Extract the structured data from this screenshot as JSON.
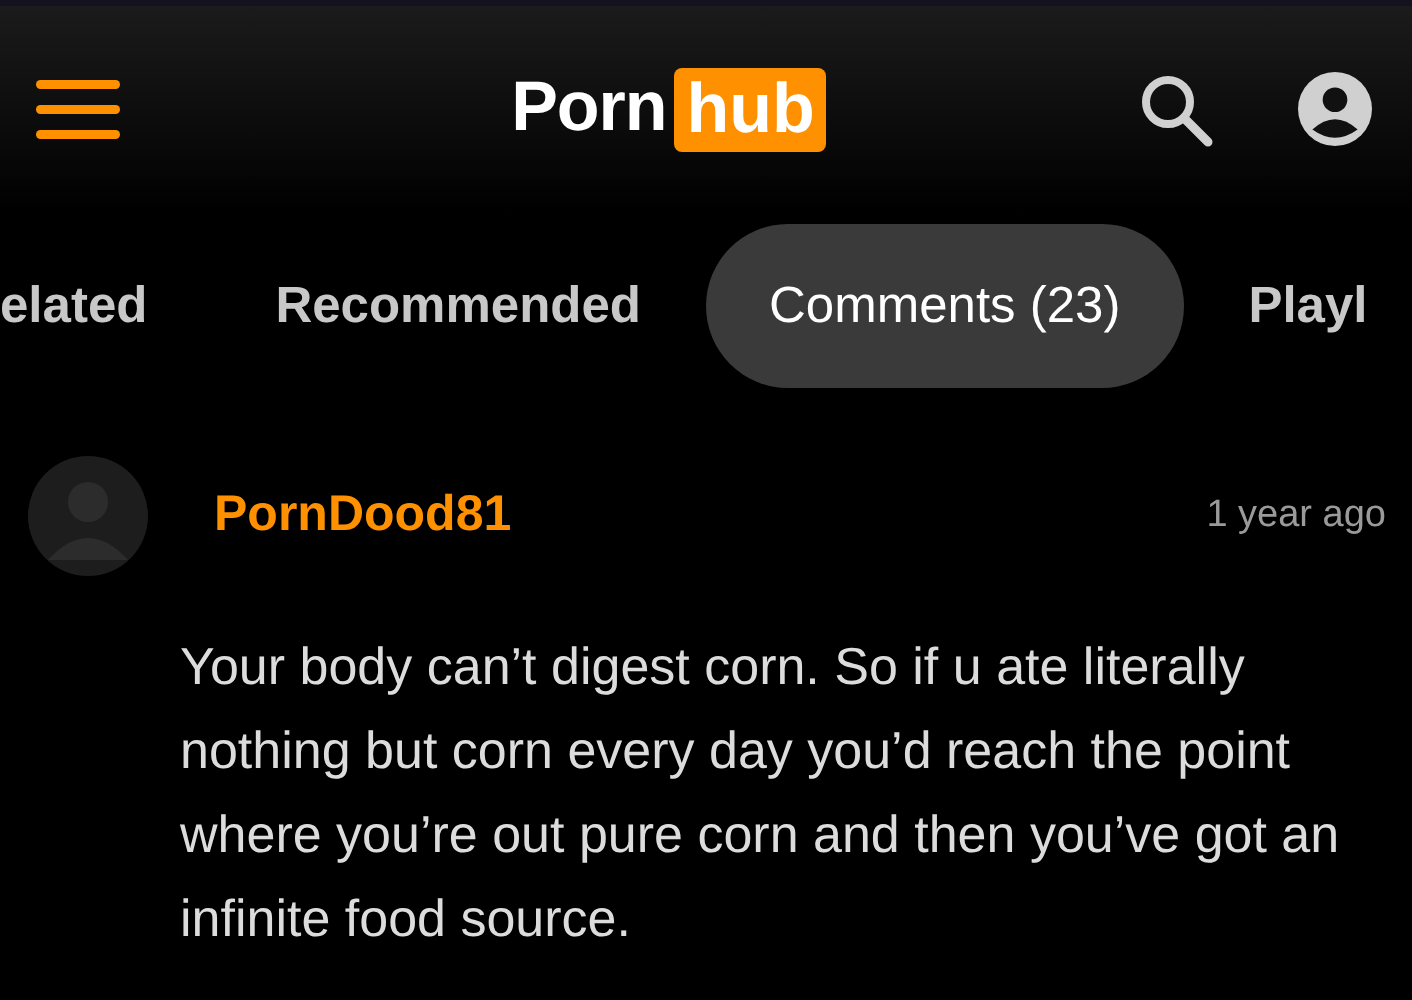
{
  "header": {
    "logo": {
      "text_1": "Porn",
      "text_2": "hub"
    }
  },
  "tabs": [
    {
      "label": "elated",
      "selected": false
    },
    {
      "label": "Recommended",
      "selected": false
    },
    {
      "label": "Comments (23)",
      "selected": true
    },
    {
      "label": "Playl",
      "selected": false
    }
  ],
  "comments": [
    {
      "author": "PornDood81",
      "time": "1 year ago",
      "text": "Your body can’t digest corn. So if u ate literally nothing but corn every day you’d reach the point where you’re out pure corn and then you’ve got an infinite food source."
    }
  ]
}
